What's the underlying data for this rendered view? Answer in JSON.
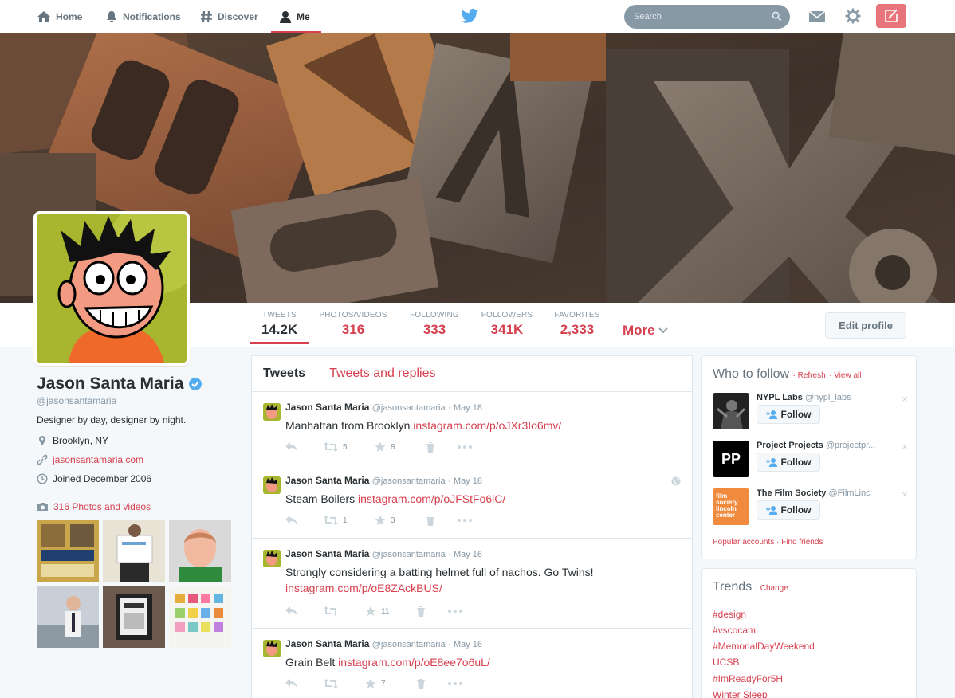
{
  "nav": {
    "home": "Home",
    "notifications": "Notifications",
    "discover": "Discover",
    "me": "Me",
    "search_placeholder": "Search"
  },
  "profile": {
    "name": "Jason Santa Maria",
    "handle": "@jasonsantamaria",
    "bio": "Designer by day, designer by night.",
    "location": "Brooklyn, NY",
    "website": "jasonsantamaria.com",
    "joined": "Joined December 2006",
    "photos_link": "316 Photos and videos"
  },
  "stats": [
    {
      "label": "TWEETS",
      "value": "14.2K"
    },
    {
      "label": "PHOTOS/VIDEOS",
      "value": "316"
    },
    {
      "label": "FOLLOWING",
      "value": "333"
    },
    {
      "label": "FOLLOWERS",
      "value": "341K"
    },
    {
      "label": "FAVORITES",
      "value": "2,333"
    }
  ],
  "more_label": "More",
  "edit_profile_label": "Edit profile",
  "timeline": {
    "tab_tweets": "Tweets",
    "tab_replies": "Tweets and replies",
    "tweets": [
      {
        "name": "Jason Santa Maria",
        "handle": "@jasonsantamaria",
        "date": "May 18",
        "text": "Manhattan from Brooklyn",
        "link": "instagram.com/p/oJXr3Io6mv/",
        "retweets": "5",
        "favorites": "8"
      },
      {
        "name": "Jason Santa Maria",
        "handle": "@jasonsantamaria",
        "date": "May 18",
        "text": "Steam Boilers",
        "link": "instagram.com/p/oJFStFo6iC/",
        "retweets": "1",
        "favorites": "3"
      },
      {
        "name": "Jason Santa Maria",
        "handle": "@jasonsantamaria",
        "date": "May 16",
        "text": "Strongly considering a batting helmet full of nachos. Go Twins!",
        "link": "instagram.com/p/oE8ZAckBUS/",
        "retweets": "",
        "favorites": "11"
      },
      {
        "name": "Jason Santa Maria",
        "handle": "@jasonsantamaria",
        "date": "May 16",
        "text": "Grain Belt",
        "link": "instagram.com/p/oE8ee7o6uL/",
        "retweets": "",
        "favorites": "7"
      }
    ]
  },
  "who_to_follow": {
    "title": "Who to follow",
    "refresh": "Refresh",
    "view_all": "View all",
    "follow_label": "Follow",
    "accounts": [
      {
        "name": "NYPL Labs",
        "handle": "@nypl_labs"
      },
      {
        "name": "Project Projects",
        "handle": "@projectpr..."
      },
      {
        "name": "The Film Society",
        "handle": "@FilmLinc"
      }
    ],
    "pp_logo": "PP",
    "film_logo": "film society lincoln center",
    "popular": "Popular accounts",
    "find_friends": "Find friends"
  },
  "trends": {
    "title": "Trends",
    "change": "Change",
    "items": [
      "#design",
      "#vscocam",
      "#MemorialDayWeekend",
      "UCSB",
      "#ImReadyFor5H",
      "Winter Sleep"
    ]
  },
  "colors": {
    "accent": "#d6404e",
    "muted": "#8899a6",
    "text": "#292f33"
  }
}
